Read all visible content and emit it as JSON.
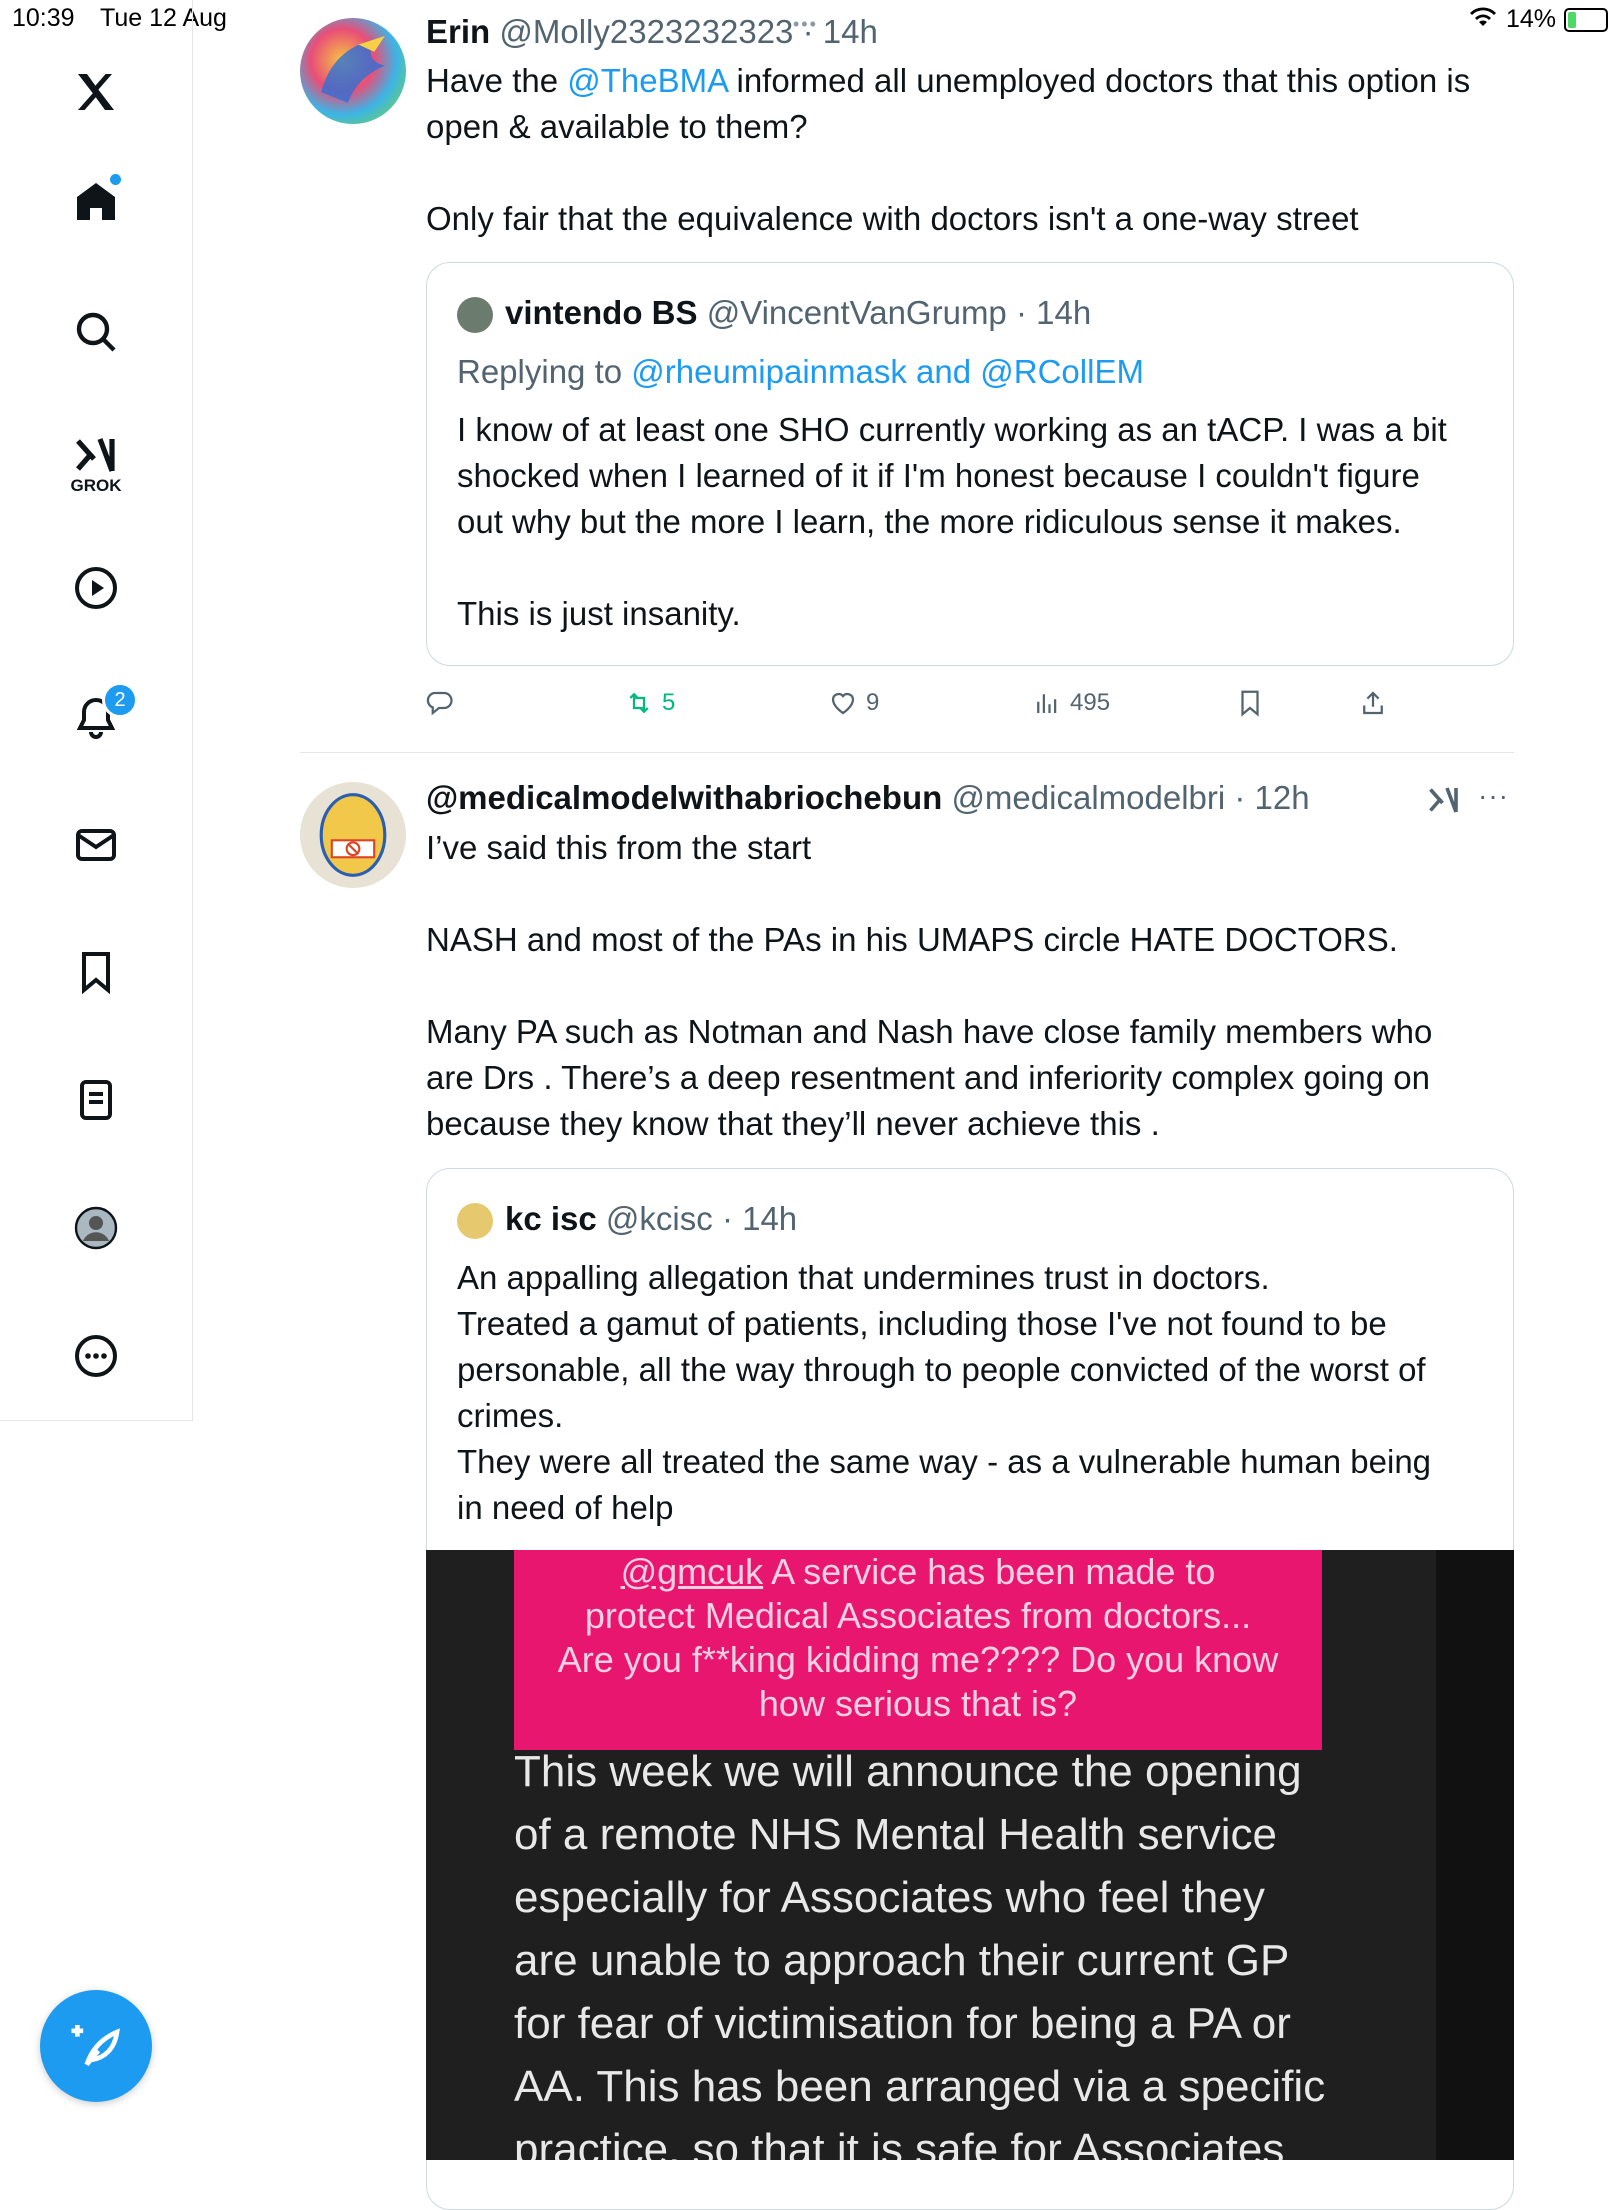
{
  "status_bar": {
    "time": "10:39",
    "date": "Tue 12 Aug",
    "battery": "14%"
  },
  "sidebar": {
    "grok_label": "GROK",
    "notification_count": "2",
    "icons": [
      "x-logo-icon",
      "home-icon",
      "search-icon",
      "grok-icon",
      "video-icon",
      "bell-icon",
      "mail-icon",
      "bookmark-icon",
      "lists-icon",
      "profile-icon",
      "more-icon"
    ]
  },
  "tweet1": {
    "name": "Erin",
    "handle": "@Molly2323232323",
    "time": "· 14h",
    "text_prefix": "Have the ",
    "mention": "@TheBMA",
    "text_suffix1": " informed all unemployed doctors that this option is",
    "text_suffix2": "open & available to them?",
    "text_line3": "Only fair that the equivalence with doctors isn't a one-way street",
    "quote": {
      "name": "vintendo BS",
      "handle": "@VincentVanGrump",
      "time": "· 14h",
      "replying_label": "Replying to ",
      "replying_to": "@rheumipainmask and @RCollEM",
      "lines": [
        "I know of at least one SHO currently working as an tACP. I was a bit",
        "shocked when I learned of it if I'm honest because I couldn't figure",
        "out why but the more I learn, the more ridiculous sense it makes.",
        "",
        "This is just insanity."
      ]
    },
    "actions": {
      "reposts": "5",
      "likes": "9",
      "views": "495"
    }
  },
  "tweet2": {
    "name": "@medicalmodelwithabriochebun",
    "handle": "@medicalmodelbri",
    "time": "· 12h",
    "lines": [
      "I’ve said this from the start",
      "",
      "NASH and most of the PAs in his UMAPS circle HATE DOCTORS.",
      "",
      "Many PA such as Notman and Nash have close family members who",
      "are Drs . There’s a deep resentment and inferiority complex going on",
      "because they know that they’ll never achieve this ."
    ],
    "quote": {
      "name": "kc isc",
      "handle": "@kcisc",
      "time": "· 14h",
      "lines": [
        "An appalling allegation that undermines trust in doctors.",
        "Treated a gamut of patients, including those I've not found to be",
        "personable, all the way through to people convicted of the worst of",
        "crimes.",
        "They were all treated the same way - as a vulnerable human being",
        "in need of help"
      ],
      "image": {
        "pink_mention": "@gmcuk",
        "pink_line1_rest": " A service has been made to",
        "pink_lines": [
          "protect Medical Associates from doctors...",
          "Are you f**king kidding me???? Do you know",
          "how serious that is?"
        ],
        "body_lines": [
          "This week we will announce the opening",
          "of a remote NHS Mental Health service",
          "especially for Associates who feel they",
          "are unable to approach their current GP",
          "for fear of victimisation for being a PA or",
          "AA. This has been arranged via a specific",
          "practice, so that it is safe for Associates"
        ]
      }
    }
  }
}
